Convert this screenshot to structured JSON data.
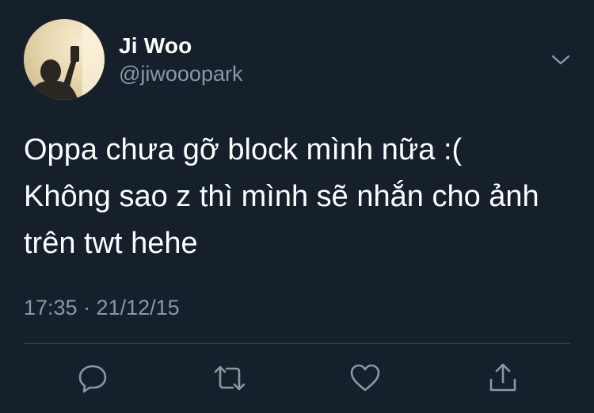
{
  "tweet": {
    "author": {
      "display_name": "Ji Woo",
      "handle": "@jiwooopark"
    },
    "text_lines": [
      "Oppa chưa gỡ block mình nữa :(",
      "Không sao z thì mình sẽ nhắn cho ảnh",
      "trên twt hehe"
    ],
    "timestamp": "17:35 · 21/12/15",
    "icons": {
      "more": "chevron-down-icon",
      "reply": "reply-icon",
      "retweet": "retweet-icon",
      "like": "heart-icon",
      "share": "share-icon"
    }
  },
  "colors": {
    "background": "#15202b",
    "primary_text": "#ffffff",
    "secondary_text": "#8899a6",
    "divider": "#38444d"
  }
}
